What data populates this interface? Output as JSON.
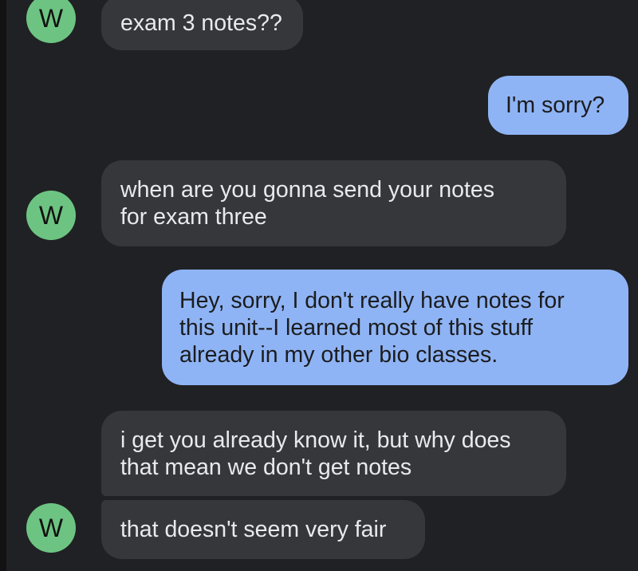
{
  "contact": {
    "avatar_letter": "W"
  },
  "messages": [
    {
      "direction": "incoming",
      "text": "exam 3 notes??"
    },
    {
      "direction": "outgoing",
      "text": "I'm sorry?"
    },
    {
      "direction": "incoming",
      "text": "when are you gonna send your notes\nfor exam three"
    },
    {
      "direction": "outgoing",
      "text": "Hey, sorry, I don't really have notes for\nthis unit--I learned most of this stuff\nalready in my other bio classes."
    },
    {
      "direction": "incoming",
      "text": "i get you already know it, but why does\nthat mean we don't get notes"
    },
    {
      "direction": "incoming",
      "text": "that doesn't seem very fair"
    }
  ],
  "colors": {
    "background": "#202124",
    "incoming_bubble": "#36373b",
    "outgoing_bubble": "#8fb4f5",
    "avatar": "#6dc482"
  }
}
